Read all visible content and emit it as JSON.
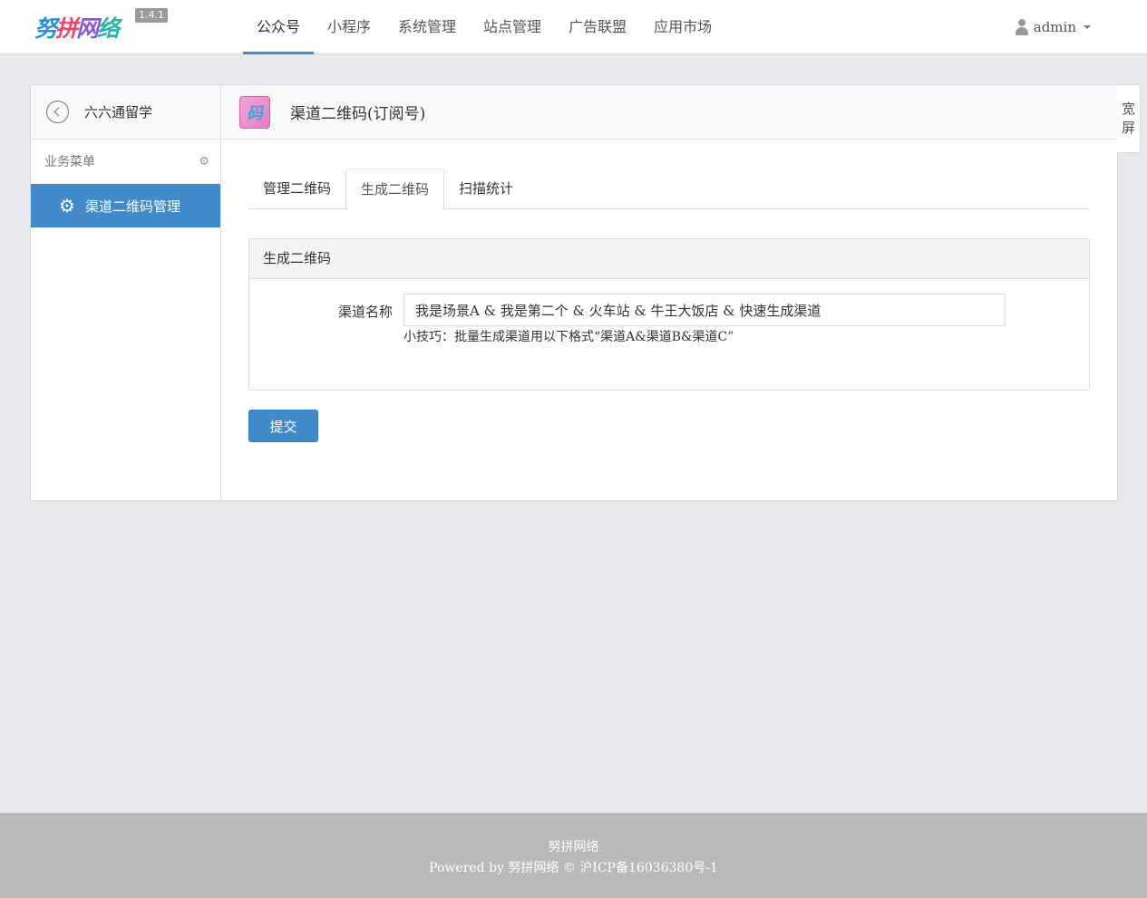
{
  "header": {
    "logo": [
      "努",
      "拼",
      "网",
      "络"
    ],
    "version": "1.4.1",
    "nav": [
      {
        "label": "公众号",
        "active": true
      },
      {
        "label": "小程序",
        "active": false
      },
      {
        "label": "系统管理",
        "active": false
      },
      {
        "label": "站点管理",
        "active": false
      },
      {
        "label": "广告联盟",
        "active": false
      },
      {
        "label": "应用市场",
        "active": false
      }
    ],
    "user": "admin"
  },
  "sidebar": {
    "title": "六六通留学",
    "section": "业务菜单",
    "items": [
      {
        "label": "渠道二维码管理",
        "icon": "gear-icon",
        "active": true
      }
    ]
  },
  "content": {
    "icon_text": "码",
    "title": "渠道二维码(订阅号)",
    "tabs": [
      {
        "label": "管理二维码",
        "active": false
      },
      {
        "label": "生成二维码",
        "active": true
      },
      {
        "label": "扫描统计",
        "active": false
      }
    ],
    "box_title": "生成二维码",
    "form": {
      "label": "渠道名称",
      "value": "我是场景A & 我是第二个 & 火车站 & 牛王大饭店 & 快速生成渠道",
      "help": "小技巧：批量生成渠道用以下格式“渠道A&渠道B&渠道C”"
    },
    "submit_label": "提交"
  },
  "wide_button": [
    "宽",
    "屏"
  ],
  "footer": {
    "line1": "努拼网络",
    "line2": "Powered by 努拼网络 © 沪ICP备16036380号-1"
  },
  "colors": {
    "accent": "#428bca",
    "background": "#e8e9ec",
    "footer": "#b8b9b8"
  }
}
